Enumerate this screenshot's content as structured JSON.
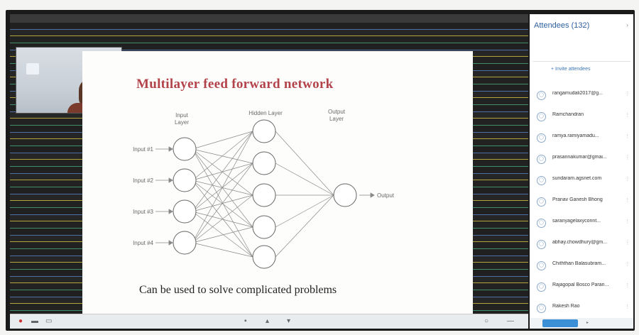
{
  "window": {
    "title": ""
  },
  "slide": {
    "title": "Multilayer feed forward network",
    "caption": "Can be used to solve complicated problems",
    "layer_labels": {
      "input": [
        "Input",
        "Layer"
      ],
      "hidden": [
        "Hidden Layer"
      ],
      "output": [
        "Output",
        "Layer"
      ]
    },
    "inputs": [
      "Input #1",
      "Input #2",
      "Input #3",
      "Input #4"
    ],
    "output_label": "Output"
  },
  "attendees": {
    "header": "Attendees (132)",
    "invite": "+ Invite attendees",
    "list": [
      {
        "name": "rangamudali2017@g..."
      },
      {
        "name": "Ramchandran"
      },
      {
        "name": "ramya.ramiyamadu..."
      },
      {
        "name": "prasannakumar@gmai..."
      },
      {
        "name": "sundaram.agsnet.com"
      },
      {
        "name": "Pranav Ganesh Bhong"
      },
      {
        "name": "saranyagelaxyconnt..."
      },
      {
        "name": "abhay.chowdhury@gm..."
      },
      {
        "name": "Chiththan Balasubram..."
      },
      {
        "name": "Rajagopal Bosco Paran..."
      },
      {
        "name": "Rakesh Rao"
      }
    ]
  },
  "icons": {
    "mic": "mic-icon",
    "camera": "camera-icon",
    "share": "share-icon",
    "more": "more-icon"
  },
  "colors": {
    "title": "#b3434a",
    "accent": "#2e5f9e",
    "footer_button": "#3b8fd6"
  }
}
